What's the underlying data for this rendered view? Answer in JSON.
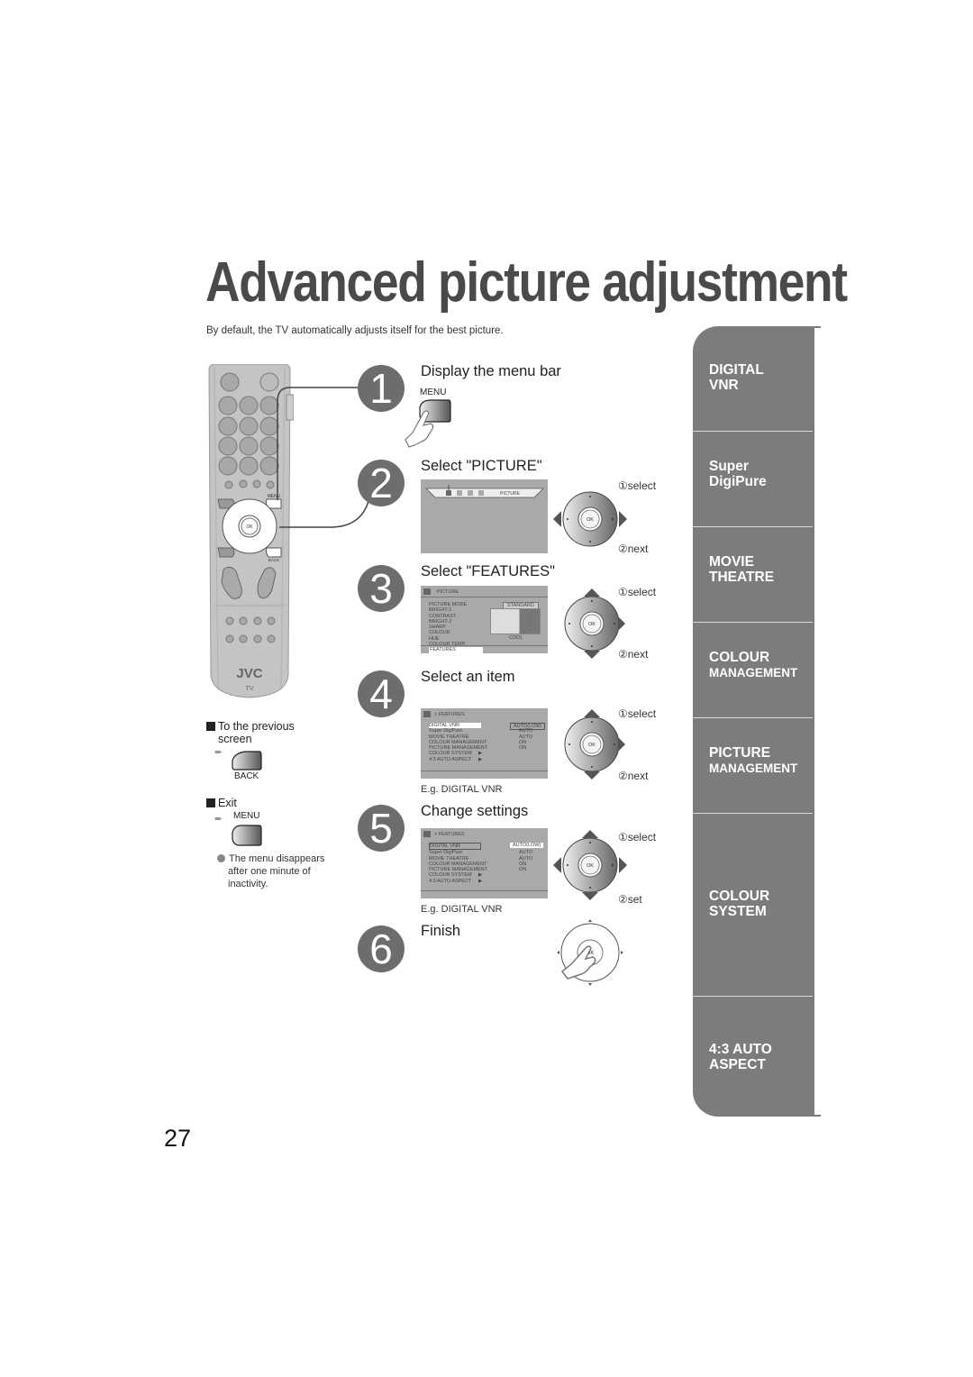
{
  "page": {
    "title": "Advanced picture adjustment",
    "intro": "By default, the TV automatically adjusts itself for the best picture.",
    "page_number": "27"
  },
  "remote": {
    "brand": "JVC",
    "label_tv": "TV",
    "label_menu": "MENU",
    "label_back": "BACK",
    "label_ok": "OK"
  },
  "side_notes": {
    "previous": {
      "title": "To the previous screen",
      "line1": "To the previous",
      "line2": "screen",
      "button": "BACK"
    },
    "exit": {
      "title": "Exit",
      "button": "MENU"
    },
    "menu_note": {
      "line1": "The menu disappears",
      "line2": "after one minute of",
      "line3": "inactivity."
    }
  },
  "steps": [
    {
      "number": "1",
      "title": "Display the menu bar",
      "button_label": "MENU"
    },
    {
      "number": "2",
      "title": "Select \"PICTURE\"",
      "labels": [
        "①select",
        "②next"
      ],
      "osd": {
        "menu_bar_label": "PICTURE"
      }
    },
    {
      "number": "3",
      "title": "Select \"FEATURES\"",
      "labels": [
        "①select",
        "②next"
      ],
      "osd": {
        "header": "PICTURE",
        "items": [
          "PICTURE MODE",
          "BRIGHT-1",
          "CONTRAST",
          "BRIGHT-2",
          "SHARP",
          "COLOUR",
          "HUE",
          "COLOUR TEMP.",
          "FEATURES"
        ],
        "picture_mode_value": "STANDARD",
        "colour_temp_value": "COOL",
        "selected": "FEATURES"
      }
    },
    {
      "number": "4",
      "title": "Select an item",
      "labels": [
        "①select",
        "②next"
      ],
      "caption": "E.g. DIGITAL VNR",
      "osd": {
        "header": "> FEATURES",
        "items": [
          {
            "name": "DIGITAL VNR",
            "value": "AUTO(LOW)"
          },
          {
            "name": "Super DigiPure",
            "value": "AUTO"
          },
          {
            "name": "MOVIE THEATRE",
            "value": "AUTO"
          },
          {
            "name": "COLOUR MANAGEMENT",
            "value": "ON"
          },
          {
            "name": "PICTURE MANAGEMENT",
            "value": "ON"
          },
          {
            "name": "COLOUR SYSTEM",
            "value": "▶"
          },
          {
            "name": "4:3 AUTO ASPECT",
            "value": "▶"
          }
        ]
      }
    },
    {
      "number": "5",
      "title": "Change settings",
      "labels": [
        "①select",
        "②set"
      ],
      "caption": "E.g. DIGITAL VNR",
      "osd": {
        "header": "> FEATURES",
        "items": [
          {
            "name": "DIGITAL VNR",
            "value": "AUTO(LOW)"
          },
          {
            "name": "Super DigiPure",
            "value": "AUTO"
          },
          {
            "name": "MOVIE THEATRE",
            "value": "AUTO"
          },
          {
            "name": "COLOUR MANAGEMENT",
            "value": "ON"
          },
          {
            "name": "PICTURE MANAGEMENT",
            "value": "ON"
          },
          {
            "name": "COLOUR SYSTEM",
            "value": "▶"
          },
          {
            "name": "4:3 AUTO ASPECT",
            "value": "▶"
          }
        ]
      }
    },
    {
      "number": "6",
      "title": "Finish"
    }
  ],
  "tabs": [
    {
      "line1": "DIGITAL",
      "line2": "VNR"
    },
    {
      "line1": "Super",
      "line2": "DigiPure"
    },
    {
      "line1": "MOVIE",
      "line2": "THEATRE"
    },
    {
      "line1": "COLOUR",
      "line2": "MANAGEMENT"
    },
    {
      "line1": "PICTURE",
      "line2": "MANAGEMENT"
    },
    {
      "line1": "COLOUR",
      "line2": "SYSTEM"
    },
    {
      "line1": "4:3 AUTO",
      "line2": "ASPECT"
    }
  ],
  "colors": {
    "tab_bg": "#7c7c7c",
    "step_circle": "#6d6d6d",
    "title": "#4a4a4a",
    "osd_bg": "#a9a9a9"
  }
}
